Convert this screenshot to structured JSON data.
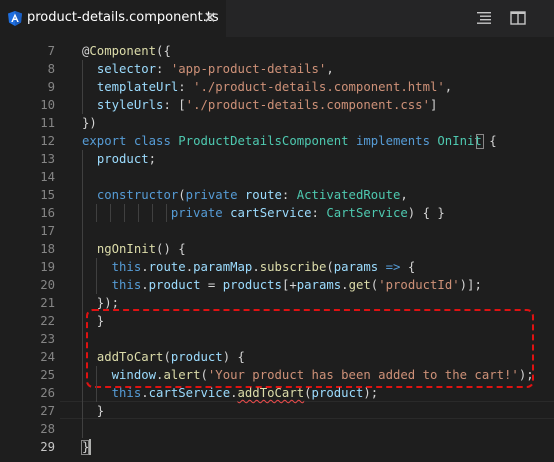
{
  "tab": {
    "title": "product-details.component.ts",
    "close_label": "✕",
    "icon": "angular-icon"
  },
  "actions": {
    "outline_icon": "outline-icon",
    "split_icon": "split-editor-icon"
  },
  "colors": {
    "keyword": "#569cd6",
    "string": "#ce9178",
    "function": "#dcdcaa",
    "class": "#4ec9b0",
    "variable": "#9cdcfe",
    "highlight_border": "#e01212"
  },
  "lines": [
    {
      "num": "7",
      "tokens": [
        [
          "pl",
          "@"
        ],
        [
          "fn",
          "Component"
        ],
        [
          "pl",
          "({"
        ]
      ]
    },
    {
      "num": "8",
      "tokens": [
        [
          "pl",
          "  "
        ],
        [
          "var",
          "selector"
        ],
        [
          "pl",
          ": "
        ],
        [
          "str",
          "'app-product-details'"
        ],
        [
          "pl",
          ","
        ]
      ]
    },
    {
      "num": "9",
      "tokens": [
        [
          "pl",
          "  "
        ],
        [
          "var",
          "templateUrl"
        ],
        [
          "pl",
          ": "
        ],
        [
          "str",
          "'./product-details.component.html'"
        ],
        [
          "pl",
          ","
        ]
      ]
    },
    {
      "num": "10",
      "tokens": [
        [
          "pl",
          "  "
        ],
        [
          "var",
          "styleUrls"
        ],
        [
          "pl",
          ": ["
        ],
        [
          "str",
          "'./product-details.component.css'"
        ],
        [
          "pl",
          "]"
        ]
      ]
    },
    {
      "num": "11",
      "tokens": [
        [
          "pl",
          "})"
        ]
      ]
    },
    {
      "num": "12",
      "tokens": [
        [
          "kw",
          "export"
        ],
        [
          "pl",
          " "
        ],
        [
          "kw",
          "class"
        ],
        [
          "pl",
          " "
        ],
        [
          "cls",
          "ProductDetailsComponent"
        ],
        [
          "pl",
          " "
        ],
        [
          "kw",
          "implements"
        ],
        [
          "pl",
          " "
        ],
        [
          "cls",
          "OnInit"
        ],
        [
          "pl",
          " {"
        ]
      ]
    },
    {
      "num": "13",
      "tokens": [
        [
          "pl",
          "  "
        ],
        [
          "var",
          "product"
        ],
        [
          "pl",
          ";"
        ]
      ]
    },
    {
      "num": "14",
      "tokens": []
    },
    {
      "num": "15",
      "tokens": [
        [
          "pl",
          "  "
        ],
        [
          "kw",
          "constructor"
        ],
        [
          "pl",
          "("
        ],
        [
          "kw",
          "private"
        ],
        [
          "pl",
          " "
        ],
        [
          "var",
          "route"
        ],
        [
          "pl",
          ": "
        ],
        [
          "cls",
          "ActivatedRoute"
        ],
        [
          "pl",
          ","
        ]
      ]
    },
    {
      "num": "16",
      "tokens": [
        [
          "pl",
          "            "
        ],
        [
          "kw",
          "private"
        ],
        [
          "pl",
          " "
        ],
        [
          "var",
          "cartService"
        ],
        [
          "pl",
          ": "
        ],
        [
          "cls",
          "CartService"
        ],
        [
          "pl",
          ") { }"
        ]
      ]
    },
    {
      "num": "17",
      "tokens": []
    },
    {
      "num": "18",
      "tokens": [
        [
          "pl",
          "  "
        ],
        [
          "fn",
          "ngOnInit"
        ],
        [
          "pl",
          "() {"
        ]
      ]
    },
    {
      "num": "19",
      "tokens": [
        [
          "pl",
          "    "
        ],
        [
          "kw",
          "this"
        ],
        [
          "pl",
          "."
        ],
        [
          "var",
          "route"
        ],
        [
          "pl",
          "."
        ],
        [
          "var",
          "paramMap"
        ],
        [
          "pl",
          "."
        ],
        [
          "fn",
          "subscribe"
        ],
        [
          "pl",
          "("
        ],
        [
          "var",
          "params"
        ],
        [
          "pl",
          " "
        ],
        [
          "kw",
          "=>"
        ],
        [
          "pl",
          " {"
        ]
      ]
    },
    {
      "num": "20",
      "tokens": [
        [
          "pl",
          "    "
        ],
        [
          "kw",
          "this"
        ],
        [
          "pl",
          "."
        ],
        [
          "var",
          "product"
        ],
        [
          "pl",
          " = "
        ],
        [
          "var",
          "products"
        ],
        [
          "pl",
          "[+"
        ],
        [
          "var",
          "params"
        ],
        [
          "pl",
          "."
        ],
        [
          "fn",
          "get"
        ],
        [
          "pl",
          "("
        ],
        [
          "str",
          "'productId'"
        ],
        [
          "pl",
          ")];"
        ]
      ]
    },
    {
      "num": "21",
      "tokens": [
        [
          "pl",
          "  });"
        ]
      ]
    },
    {
      "num": "22",
      "tokens": [
        [
          "pl",
          "  }"
        ]
      ]
    },
    {
      "num": "23",
      "tokens": []
    },
    {
      "num": "24",
      "tokens": [
        [
          "pl",
          "  "
        ],
        [
          "fn",
          "addToCart"
        ],
        [
          "pl",
          "("
        ],
        [
          "var",
          "product"
        ],
        [
          "pl",
          ") {"
        ]
      ]
    },
    {
      "num": "25",
      "tokens": [
        [
          "pl",
          "    "
        ],
        [
          "var",
          "window"
        ],
        [
          "pl",
          "."
        ],
        [
          "fn",
          "alert"
        ],
        [
          "pl",
          "("
        ],
        [
          "str",
          "'Your product has been added to the cart!'"
        ],
        [
          "pl",
          ");"
        ]
      ]
    },
    {
      "num": "26",
      "tokens": [
        [
          "pl",
          "    "
        ],
        [
          "kw",
          "this"
        ],
        [
          "pl",
          "."
        ],
        [
          "var",
          "cartService"
        ],
        [
          "pl",
          "."
        ],
        [
          "fn sq",
          "addToCart"
        ],
        [
          "pl",
          "("
        ],
        [
          "var",
          "product"
        ],
        [
          "pl",
          ");"
        ]
      ]
    },
    {
      "num": "27",
      "tokens": [
        [
          "pl",
          "  }"
        ]
      ]
    },
    {
      "num": "28",
      "tokens": []
    },
    {
      "num": "29",
      "tokens": [
        [
          "pl",
          "}"
        ]
      ]
    }
  ]
}
